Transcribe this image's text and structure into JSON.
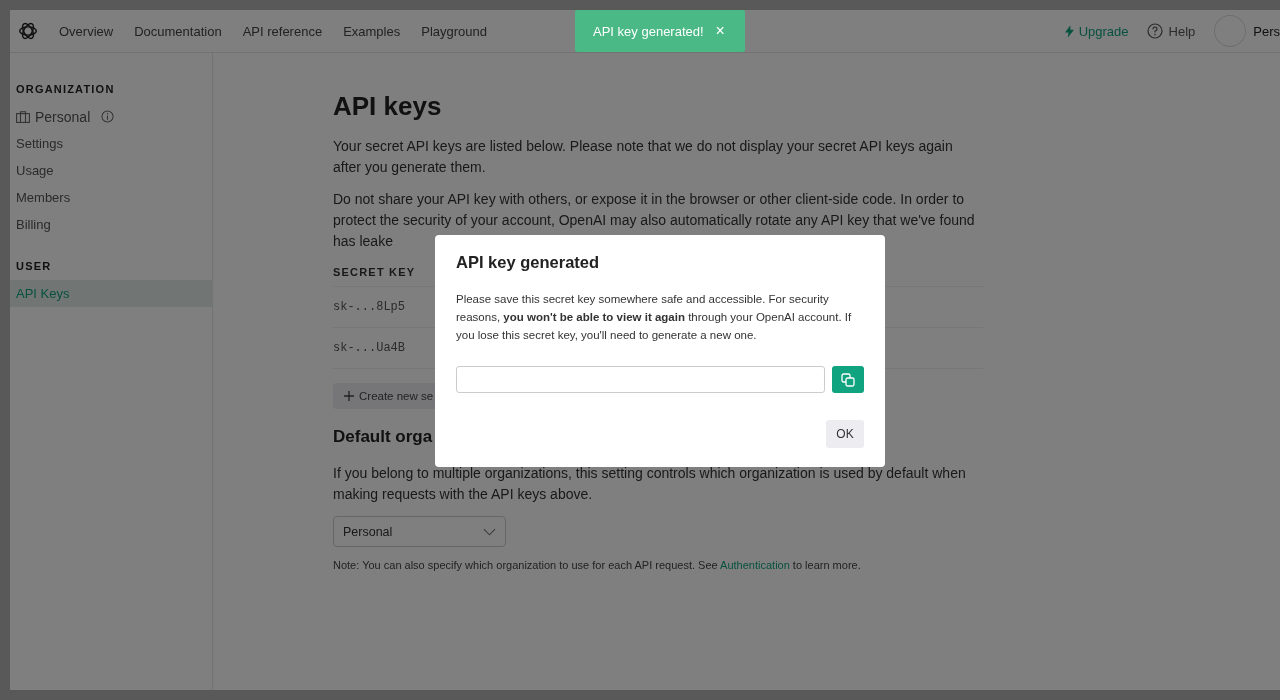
{
  "nav": {
    "links": [
      "Overview",
      "Documentation",
      "API reference",
      "Examples",
      "Playground"
    ],
    "upgrade": "Upgrade",
    "help": "Help",
    "account": "Pers"
  },
  "toast": {
    "message": "API key generated!",
    "close": "×"
  },
  "sidebar": {
    "sections": [
      {
        "heading": "ORGANIZATION",
        "items": [
          {
            "label": "Personal",
            "kind": "org",
            "selected": false
          },
          {
            "label": "Settings",
            "kind": "link",
            "selected": false
          },
          {
            "label": "Usage",
            "kind": "link",
            "selected": false
          },
          {
            "label": "Members",
            "kind": "link",
            "selected": false
          },
          {
            "label": "Billing",
            "kind": "link",
            "selected": false
          }
        ]
      },
      {
        "heading": "USER",
        "items": [
          {
            "label": "API Keys",
            "kind": "link",
            "selected": true
          }
        ]
      }
    ]
  },
  "main": {
    "title": "API keys",
    "paragraphs": [
      "Your secret API keys are listed below. Please note that we do not display your secret API keys again after you generate them.",
      "Do not share your API key with others, or expose it in the browser or other client-side code. In order to protect the security of your account, OpenAI may also automatically rotate any API key that we've found has leake"
    ],
    "table": {
      "column": "SECRET KEY",
      "rows": [
        {
          "key": "sk-...8Lp5"
        },
        {
          "key": "sk-...Ua4B"
        }
      ]
    },
    "create_button": "Create new se",
    "default_org": {
      "heading": "Default orga",
      "description": "If you belong to multiple organizations, this setting controls which organization is used by default when making requests with the API keys above.",
      "select": {
        "value": "Personal"
      },
      "note": "Note: You can also specify which organization to use for each API request. See ",
      "link": "Authentication",
      "note_end": " to learn more."
    }
  },
  "modal": {
    "title": "API key generated",
    "body": "Please save this secret key somewhere safe and accessible. For security reasons, **you won't be able to view it again** through your OpenAI account. If you lose this secret key, you'll need to generate a new one.",
    "ok": "OK"
  }
}
